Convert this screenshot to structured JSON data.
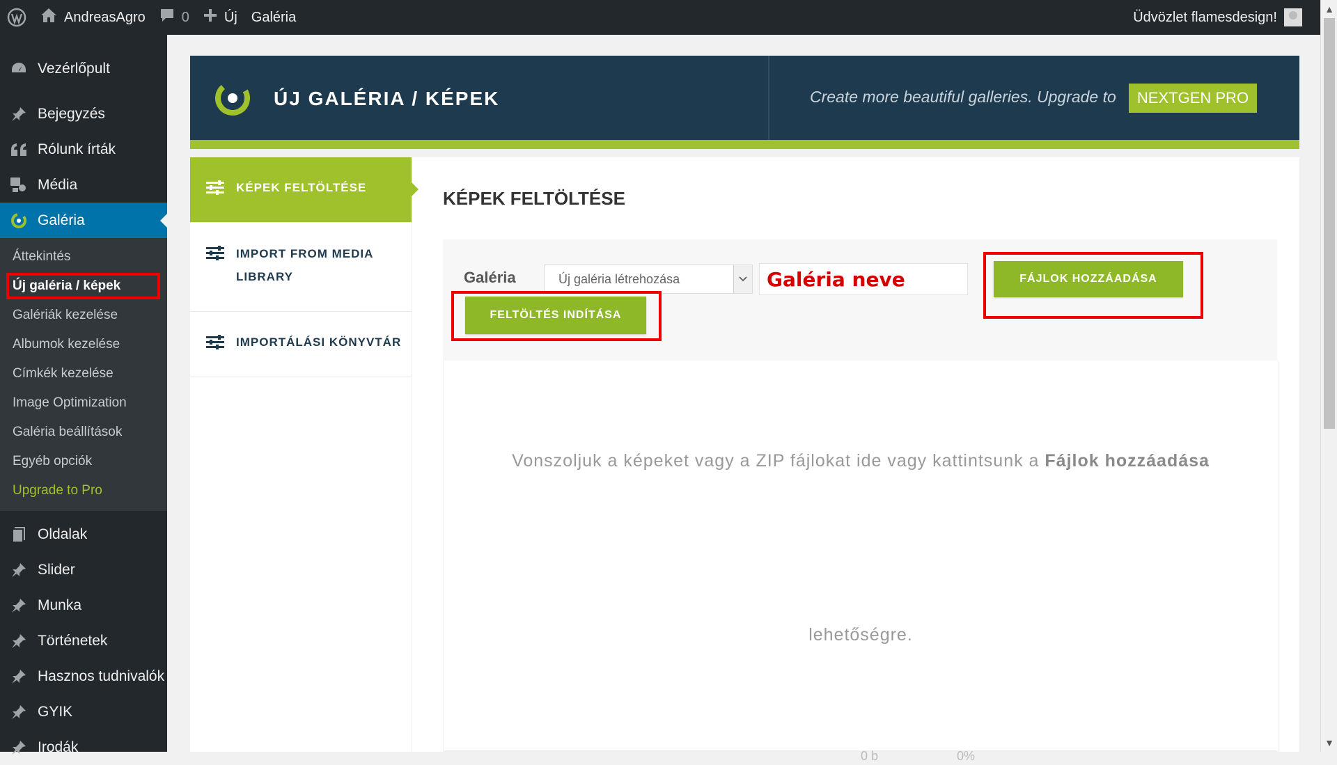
{
  "adminbar": {
    "site_name": "AndreasAgro",
    "comments_count": "0",
    "new_label": "Új",
    "gallery_label": "Galéria",
    "greeting": "Üdvözlet flamesdesign!"
  },
  "sidebar": {
    "items_top": [
      {
        "label": "Vezérlőpult",
        "icon": "dashboard-icon"
      },
      {
        "label": "Bejegyzés",
        "icon": "pin-icon"
      },
      {
        "label": "Rólunk írták",
        "icon": "quote-icon"
      },
      {
        "label": "Média",
        "icon": "media-icon"
      },
      {
        "label": "Galéria",
        "icon": "nextgen-icon",
        "active": true
      }
    ],
    "submenu": [
      "Áttekintés",
      "Új galéria / képek",
      "Galériák kezelése",
      "Albumok kezelése",
      "Címkék kezelése",
      "Image Optimization",
      "Galéria beállítások",
      "Egyéb opciók",
      "Upgrade to Pro"
    ],
    "items_bottom": [
      {
        "label": "Oldalak",
        "icon": "pages-icon"
      },
      {
        "label": "Slider",
        "icon": "pin-icon"
      },
      {
        "label": "Munka",
        "icon": "pin-icon"
      },
      {
        "label": "Történetek",
        "icon": "pin-icon"
      },
      {
        "label": "Hasznos tudnivalók",
        "icon": "pin-icon"
      },
      {
        "label": "GYIK",
        "icon": "pin-icon"
      },
      {
        "label": "Irodák",
        "icon": "pin-icon"
      }
    ]
  },
  "header": {
    "title": "ÚJ GALÉRIA / KÉPEK",
    "promo": "Create more beautiful galleries. Upgrade to",
    "pro_button": "NEXTGEN PRO",
    "colors": {
      "dark": "#1e3a4f",
      "accent": "#9fc22c"
    }
  },
  "tabs": [
    {
      "label": "KÉPEK FELTÖLTÉSE",
      "active": true
    },
    {
      "label": "IMPORT FROM MEDIA LIBRARY"
    },
    {
      "label": "IMPORTÁLÁSI KÖNYVTÁR"
    }
  ],
  "main": {
    "title": "KÉPEK FELTÖLTÉSE",
    "gallery_label": "Galéria",
    "gallery_select_value": "Új galéria létrehozása",
    "gallery_name_value": "Galéria neve",
    "add_files_button": "FÁJLOK HOZZÁADÁSA",
    "start_upload_button": "FELTÖLTÉS INDÍTÁSA",
    "drop_text_prefix": "Vonszoljuk a képeket vagy a ZIP fájlokat ide vagy kattintsunk a",
    "drop_text_bold": "Fájlok hozzáadása",
    "drop_text_end": "lehetőségre.",
    "status_size": "0 b",
    "status_percent": "0%"
  }
}
